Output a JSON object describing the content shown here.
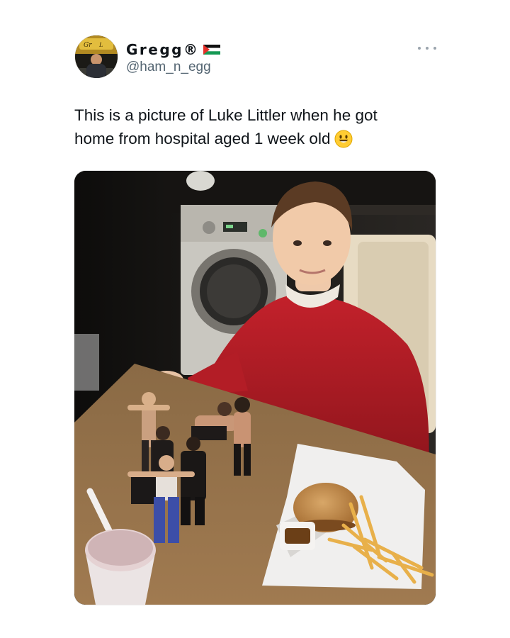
{
  "tweet": {
    "display_name": "Gregg®",
    "username": "@ham_n_egg",
    "text_line_1": "This is a picture of Luke Littler when he got",
    "text_line_2": "home from hospital aged 1 week old",
    "emoji": "smiling-face-icon",
    "more_menu": "more-options-icon",
    "verified_flag": "palestine-flag-icon",
    "photo_description_icon": "photo-image"
  },
  "colors": {
    "text_primary": "#0f1419",
    "text_secondary": "#536471",
    "background": "#ffffff"
  }
}
